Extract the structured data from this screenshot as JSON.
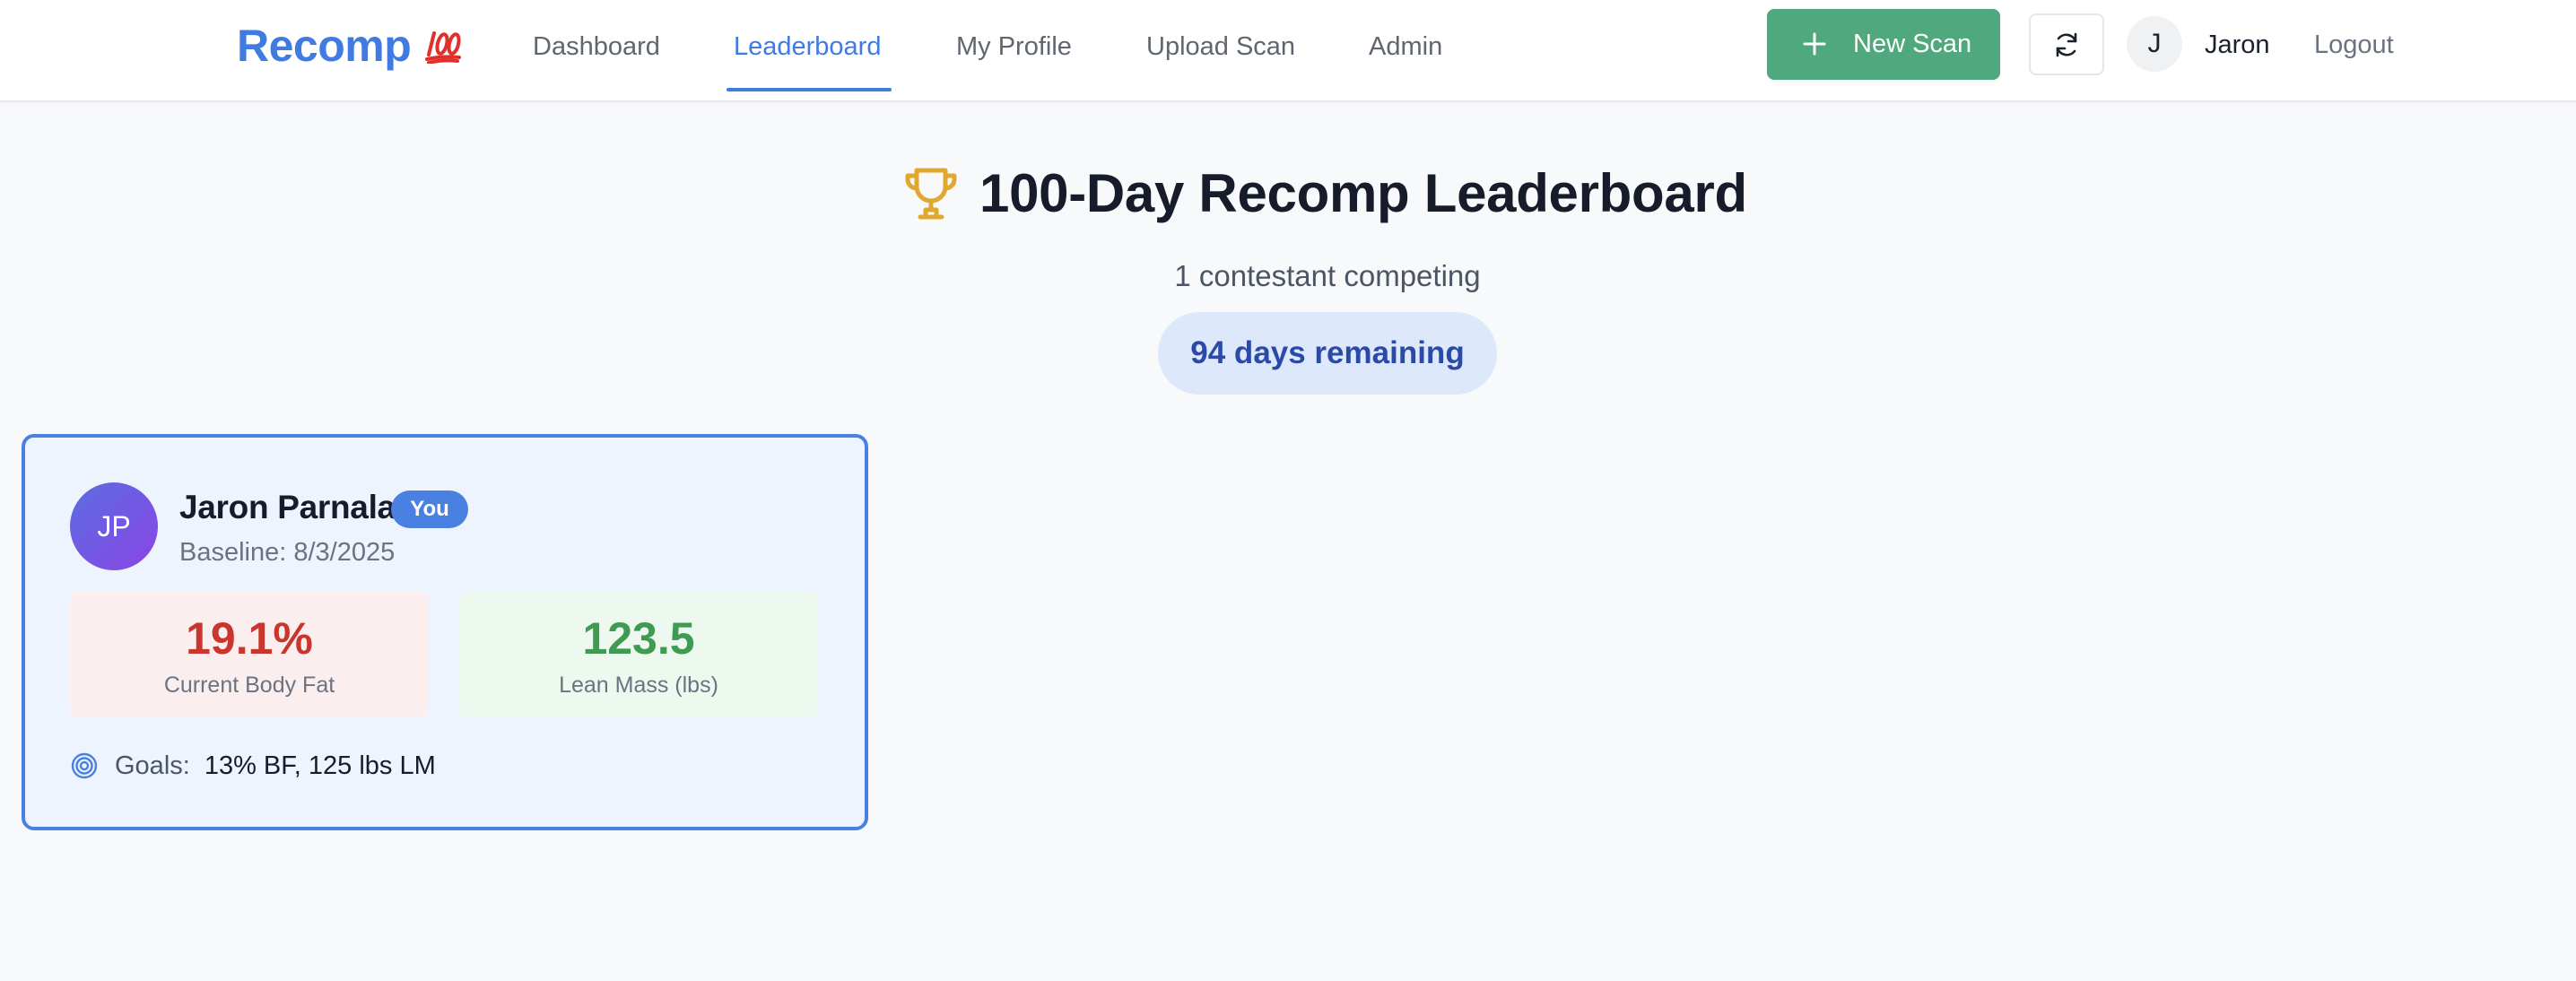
{
  "header": {
    "brand": "Recomp",
    "brand_emoji": "100-emoji",
    "nav": [
      {
        "label": "Dashboard",
        "active": false
      },
      {
        "label": "Leaderboard",
        "active": true
      },
      {
        "label": "My Profile",
        "active": false
      },
      {
        "label": "Upload Scan",
        "active": false
      },
      {
        "label": "Admin",
        "active": false
      }
    ],
    "new_scan_label": "New Scan",
    "refresh_icon": "refresh-icon",
    "user_initial": "J",
    "user_name": "Jaron",
    "logout_label": "Logout"
  },
  "hero": {
    "icon": "trophy-icon",
    "title": "100-Day Recomp Leaderboard",
    "contestants": "1 contestant competing",
    "days_remaining": "94 days remaining"
  },
  "leaderboard": [
    {
      "initials": "JP",
      "name": "Jaron Parnala",
      "badge": "You",
      "baseline": "Baseline: 8/3/2025",
      "body_fat_value": "19.1%",
      "body_fat_label": "Current Body Fat",
      "lean_mass_value": "123.5",
      "lean_mass_label": "Lean Mass (lbs)",
      "goals_label": "Goals:",
      "goals_value": "13% BF,  125 lbs LM"
    }
  ],
  "colors": {
    "accent": "#3f7be0",
    "primary_button": "#4fa87e",
    "body_fat": "#c8362d",
    "lean_mass": "#3f9a52",
    "pill_bg": "#dde8fb",
    "pill_text": "#2b4aa8"
  }
}
